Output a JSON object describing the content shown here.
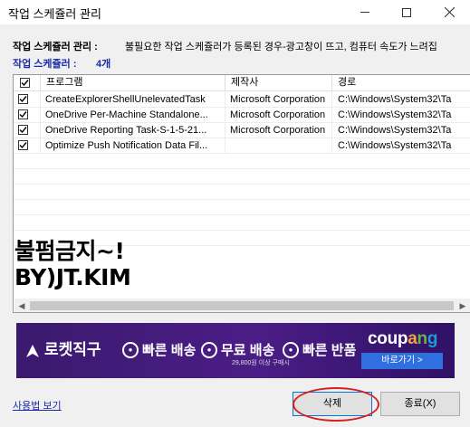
{
  "window": {
    "title": "작업 스케쥴러 관리"
  },
  "info": {
    "label": "작업 스케쥴러 관리 :",
    "description": "불필요한 작업 스케쥴러가 등록된 경우-광고창이 뜨고, 컴퓨터 속도가 느려집",
    "count_label": "작업 스케쥴러 :",
    "count_value": "4개"
  },
  "table": {
    "columns": [
      "프로그램",
      "제작사",
      "경로"
    ],
    "header_checked": true,
    "rows": [
      {
        "checked": true,
        "program": "CreateExplorerShellUnelevatedTask",
        "maker": "Microsoft Corporation",
        "path": "C:\\Windows\\System32\\Ta"
      },
      {
        "checked": true,
        "program": "OneDrive Per-Machine Standalone...",
        "maker": "Microsoft Corporation",
        "path": "C:\\Windows\\System32\\Ta"
      },
      {
        "checked": true,
        "program": "OneDrive Reporting Task-S-1-5-21...",
        "maker": "Microsoft Corporation",
        "path": "C:\\Windows\\System32\\Ta"
      },
      {
        "checked": true,
        "program": "Optimize Push Notification Data Fil...",
        "maker": "",
        "path": "C:\\Windows\\System32\\Ta"
      }
    ]
  },
  "watermark": {
    "line1": "불펌금지~!",
    "line2": "BY)JT.KIM"
  },
  "banner": {
    "rocket": "로켓직구",
    "fast": "빠른 배송",
    "free": "무료 배송",
    "free_sub": "29,800원 이상 구매시",
    "returns": "빠른 반품",
    "brand": "coupang",
    "cta": "바로가기 >",
    "brand_colors": [
      "#9b2c1f",
      "#f3a33c",
      "#e6c22a",
      "#6fb340",
      "#1e9bd7",
      "#c54b8c"
    ]
  },
  "footer": {
    "howto": "사용법 보기",
    "delete": "삭제",
    "close": "종료(X)"
  },
  "colors": {
    "link": "#1a2aa8",
    "accent_border": "#0078d7",
    "banner_bg": "#3a1270",
    "highlight_circle": "#d42020"
  }
}
